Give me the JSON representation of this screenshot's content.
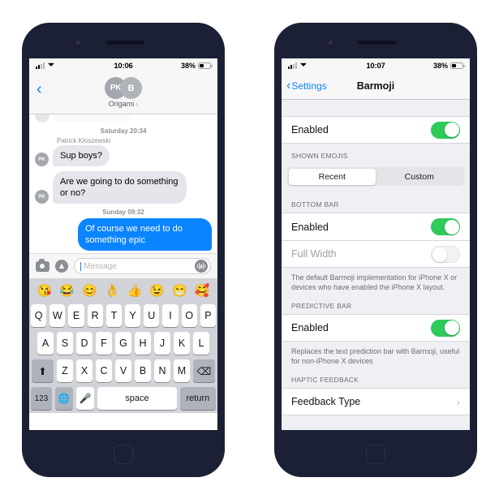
{
  "left_phone": {
    "status_bar": {
      "time": "10:06",
      "battery_percent": "38%",
      "signal_icon": "signal-bars-icon",
      "wifi_icon": "wifi-icon",
      "battery_icon": "battery-icon"
    },
    "header": {
      "back_icon": "chevron-left-icon",
      "avatar_initials": [
        "PK",
        "B"
      ],
      "conversation_name": "Origami",
      "disclosure": "›"
    },
    "conversation": {
      "groups": [
        {
          "timestamp": "Saturday 20:34",
          "sender": "Patrick Kloszewski",
          "messages": [
            {
              "avatar": "PK",
              "text": "Sup boys?",
              "direction": "in"
            },
            {
              "avatar": "PK",
              "text": "Are we going to do something or no?",
              "direction": "in"
            }
          ]
        },
        {
          "timestamp": "Sunday 09:32",
          "sender": "",
          "messages": [
            {
              "avatar": "",
              "text": "Of course we need to do something epic",
              "direction": "out"
            }
          ]
        }
      ],
      "bubble_in_color": "#e6e5eb",
      "bubble_out_color": "#0b84ff"
    },
    "input_bar": {
      "camera_icon": "camera-icon",
      "appstore_icon": "app-store-icon",
      "placeholder": "Message",
      "audio_icon": "audio-waveform-icon"
    },
    "emoji_bar": [
      "😘",
      "😂",
      "😊",
      "👌",
      "👍",
      "😉",
      "😁",
      "🥰"
    ],
    "keyboard": {
      "row1": [
        "Q",
        "W",
        "E",
        "R",
        "T",
        "Y",
        "U",
        "I",
        "O",
        "P"
      ],
      "row2": [
        "A",
        "S",
        "D",
        "F",
        "G",
        "H",
        "J",
        "K",
        "L"
      ],
      "row3_shift": "⬆",
      "row3": [
        "Z",
        "X",
        "C",
        "V",
        "B",
        "N",
        "M"
      ],
      "row3_delete": "⌫",
      "numbers_key": "123",
      "globe_key": "🌐",
      "mic_key": "🎤",
      "space_key": "space",
      "return_key": "return"
    }
  },
  "right_phone": {
    "status_bar": {
      "time": "10:07",
      "battery_percent": "38%",
      "signal_icon": "signal-bars-icon",
      "wifi_icon": "wifi-icon",
      "battery_icon": "battery-icon"
    },
    "header": {
      "back_label": "Settings",
      "back_icon": "chevron-left-icon",
      "title": "Barmoji"
    },
    "sections": [
      {
        "header": "",
        "rows": [
          {
            "label": "Enabled",
            "control": "toggle",
            "value": "on"
          }
        ],
        "footnote": ""
      },
      {
        "header": "SHOWN EMOJIS",
        "segmented": {
          "options": [
            "Recent",
            "Custom"
          ],
          "selected": "Recent"
        }
      },
      {
        "header": "BOTTOM BAR",
        "rows": [
          {
            "label": "Enabled",
            "control": "toggle",
            "value": "on"
          },
          {
            "label": "Full Width",
            "control": "toggle",
            "value": "off",
            "disabled": true
          }
        ],
        "footnote": "The default Barmoji implementation for iPhone X or devices who have enabled the iPhone X layout."
      },
      {
        "header": "PREDICTIVE BAR",
        "rows": [
          {
            "label": "Enabled",
            "control": "toggle",
            "value": "on"
          }
        ],
        "footnote": "Replaces the text prediction bar with Barmoji, useful for non-iPhone X devices"
      },
      {
        "header": "HAPTIC FEEDBACK",
        "rows": [
          {
            "label": "Feedback Type",
            "control": "disclosure",
            "value": "›"
          }
        ],
        "footnote": ""
      }
    ]
  },
  "colors": {
    "bezel": "#1b2034",
    "ios_blue": "#0b84ff",
    "toggle_green": "#2ecb5a",
    "settings_bg": "#efeff4",
    "keyboard_bg": "#d1d3d9"
  }
}
